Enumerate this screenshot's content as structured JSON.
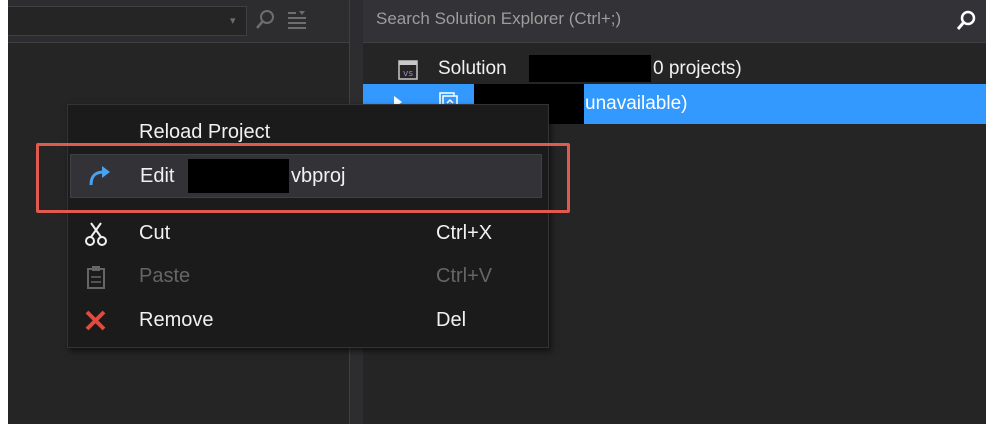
{
  "solution_explorer": {
    "search_placeholder": "Search Solution Explorer (Ctrl+;)",
    "solution_label": "Solution",
    "solution_suffix": "0 projects)",
    "project_suffix": "unavailable)"
  },
  "context_menu": {
    "items": [
      {
        "label": "Reload Project",
        "shortcut": "",
        "icon": "none",
        "enabled": true
      },
      {
        "label_prefix": "Edit",
        "label_suffix": "vbproj",
        "shortcut": "",
        "icon": "edit-arrow-icon",
        "enabled": true
      },
      {
        "label": "Cut",
        "shortcut": "Ctrl+X",
        "icon": "scissors-icon",
        "enabled": true
      },
      {
        "label": "Paste",
        "shortcut": "Ctrl+V",
        "icon": "clipboard-icon",
        "enabled": false
      },
      {
        "label": "Remove",
        "shortcut": "Del",
        "icon": "remove-x-icon",
        "enabled": true
      }
    ]
  },
  "colors": {
    "selection": "#3399ff",
    "highlight_box": "#e05a50",
    "edit_icon": "#4aa3f0",
    "remove_icon": "#e8473b"
  }
}
